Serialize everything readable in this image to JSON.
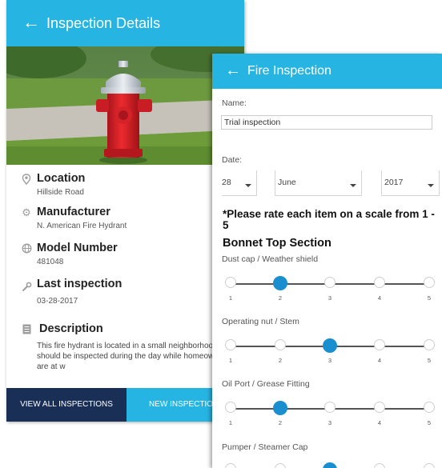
{
  "details_screen": {
    "title": "Inspection Details",
    "fields": [
      {
        "label": "Location",
        "value": "Hillside Road",
        "icon": "location-pin-icon"
      },
      {
        "label": "Manufacturer",
        "value": "N. American Fire Hydrant",
        "icon": "gear-icon"
      },
      {
        "label": "Model Number",
        "value": "481048",
        "icon": "globe-icon"
      },
      {
        "label": "Last inspection",
        "value": "03-28-2017",
        "icon": "wrench-icon"
      },
      {
        "label": "Description",
        "value": "This fire hydrant is located in a small neighborhood, so it should be inspected during the day while homeowners are at w",
        "icon": "document-icon"
      }
    ],
    "footer": {
      "view_all": "VIEW ALL INSPECTIONS",
      "new_inspection": "NEW INSPECTIO"
    }
  },
  "inspection_screen": {
    "title": "Fire Inspection",
    "name_label": "Name:",
    "name_value": "Trial inspection",
    "date_label": "Date:",
    "day": "28",
    "month": "June",
    "year": "2017",
    "instructions": "*Please rate each item on a scale from 1 - 5",
    "section_title": "Bonnet Top Section",
    "scale": [
      "1",
      "2",
      "3",
      "4",
      "5"
    ],
    "questions": [
      {
        "label": "Dust cap / Weather shield",
        "selected": 2
      },
      {
        "label": "Operating nut / Stem",
        "selected": 3
      },
      {
        "label": "Oil Port / Grease Fitting",
        "selected": 2
      },
      {
        "label": "Pumper / Steamer Cap",
        "selected": 3
      }
    ]
  },
  "colors": {
    "header": "#26b4e2",
    "footer_dark": "#1a2f56",
    "selected_dot": "#1a8fd0"
  }
}
